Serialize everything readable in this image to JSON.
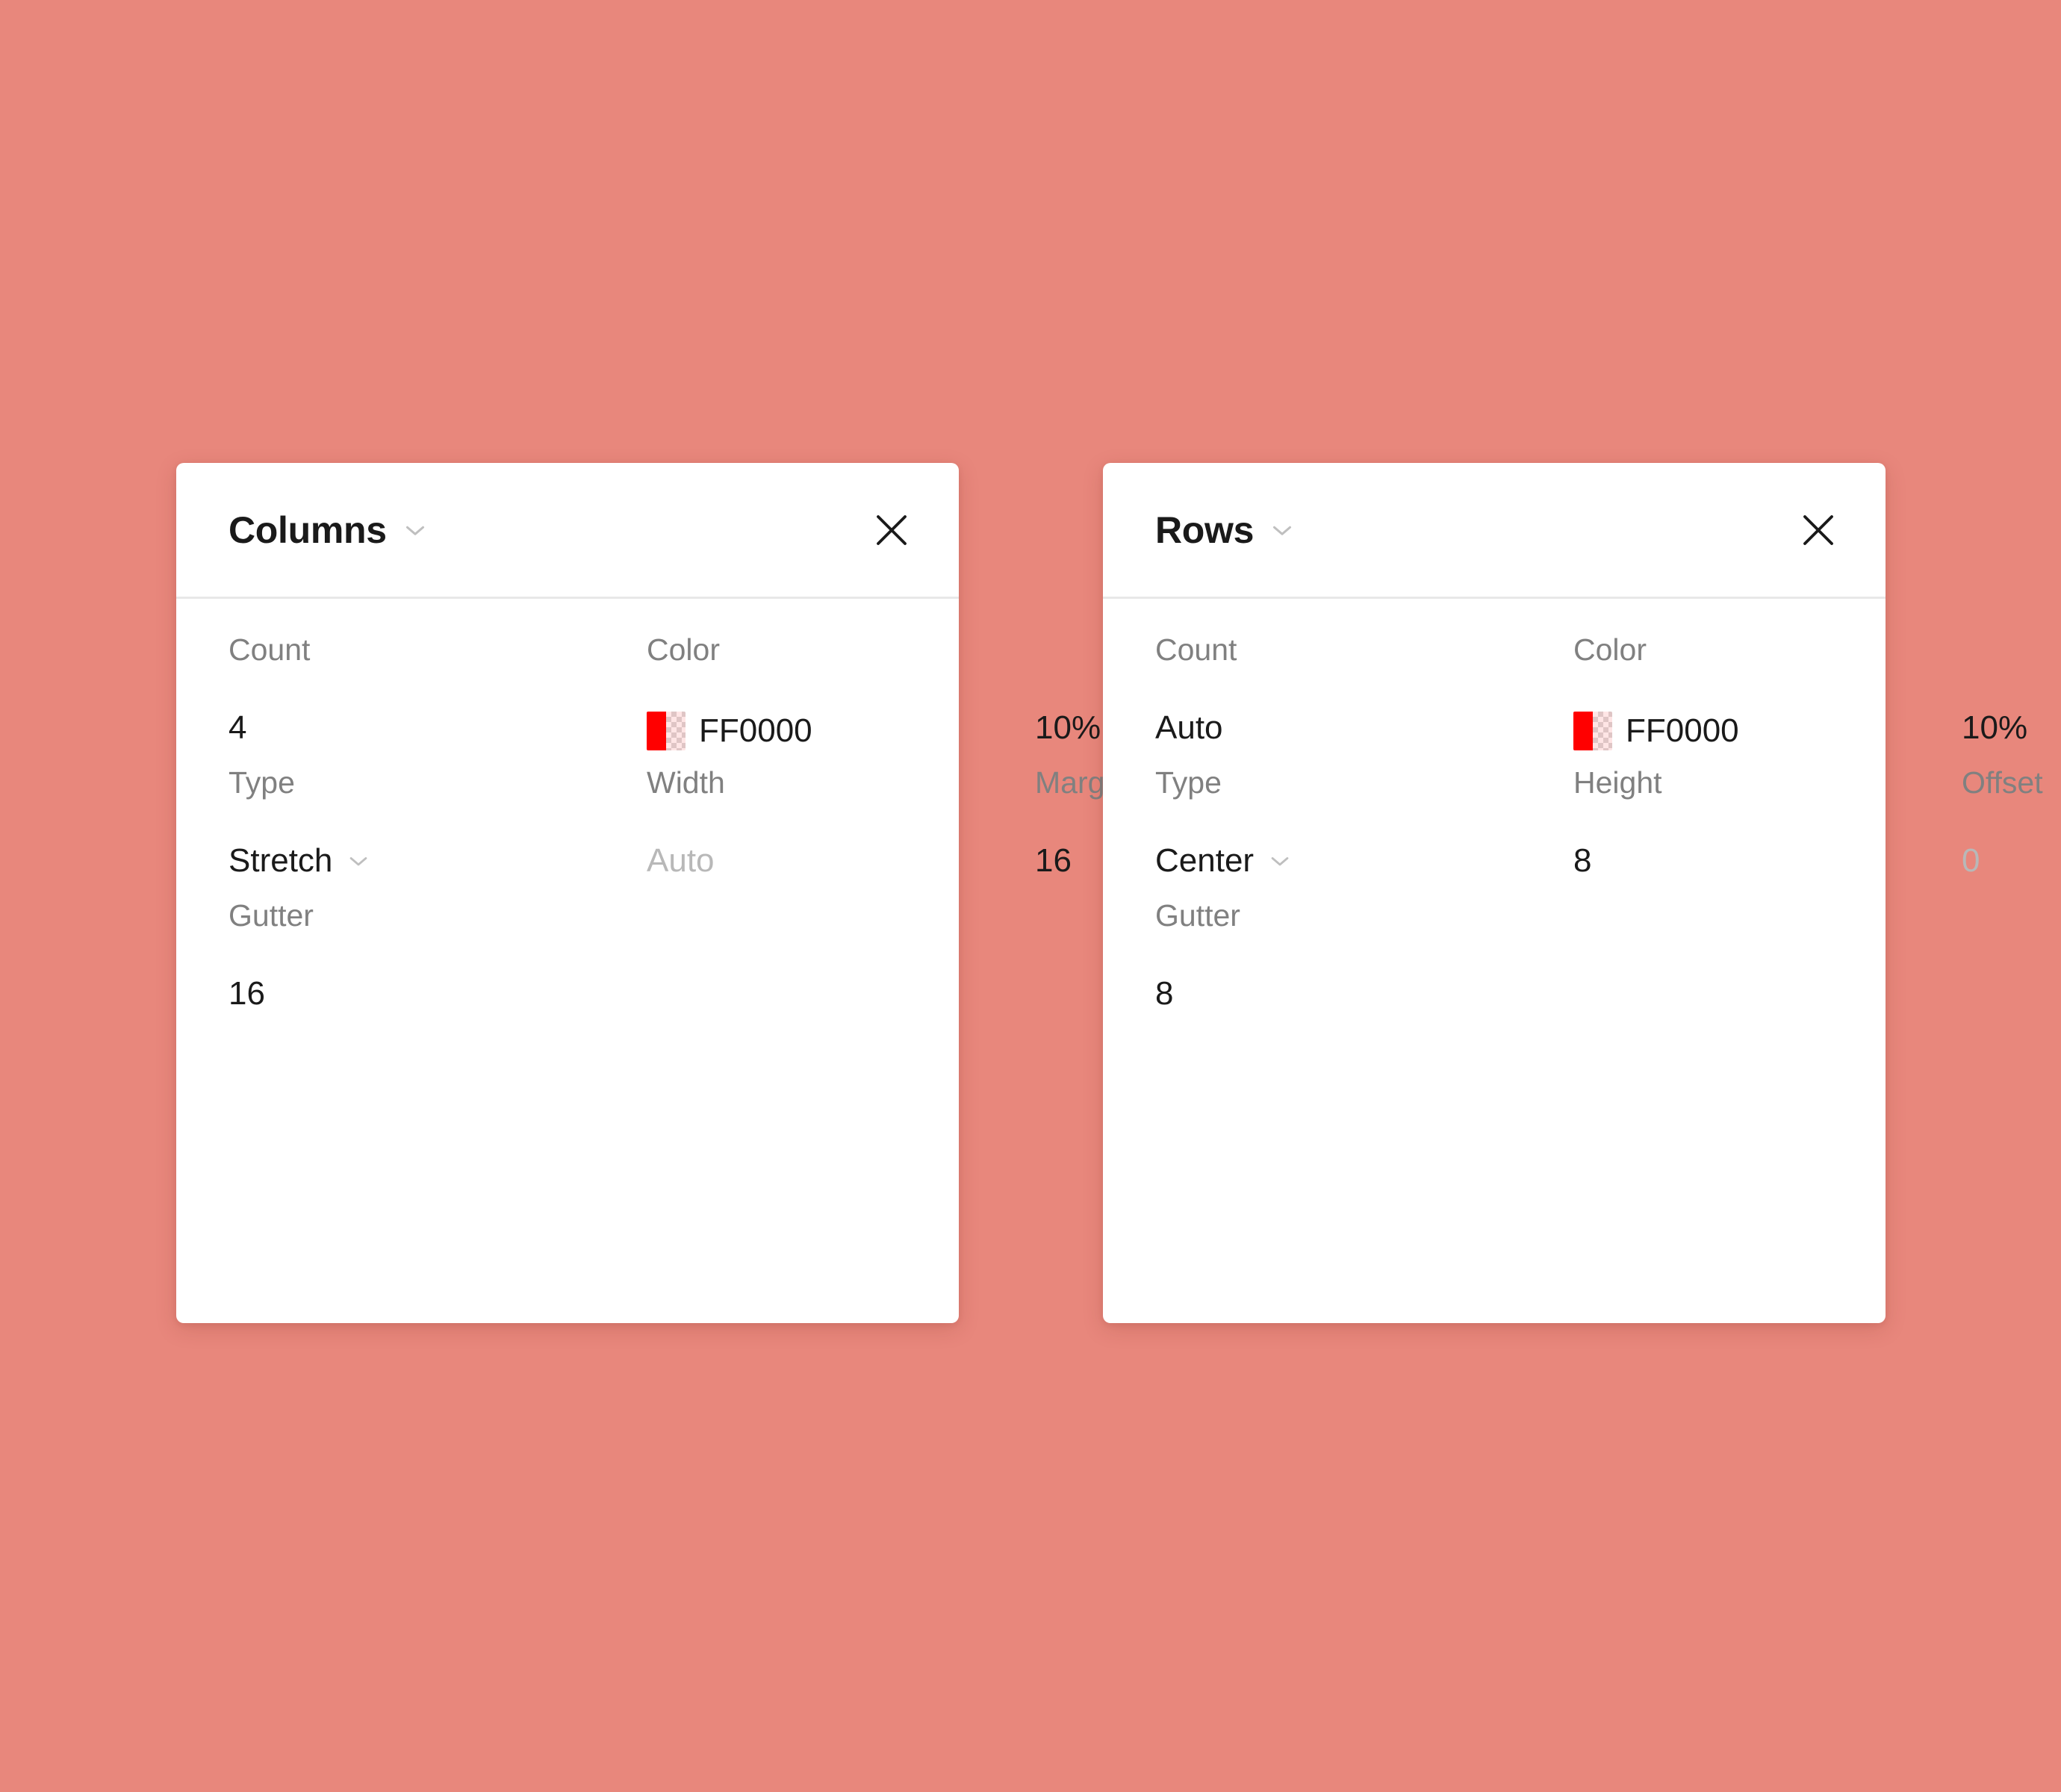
{
  "background_color": "#E8877C",
  "panels": [
    {
      "id": "columns",
      "title": "Columns",
      "title_chevron_icon": "chevron-down-icon",
      "close_icon": "close-icon",
      "rows": [
        {
          "cells": [
            {
              "label": "Count",
              "value": "4",
              "kind": "input"
            },
            {
              "label": "Color",
              "value": "FF0000",
              "kind": "color",
              "swatch_color": "#FF0000",
              "swatch_alpha_tint": "rgba(255,0,0,0.10)"
            },
            {
              "label": "",
              "value": "10%",
              "kind": "input"
            }
          ]
        },
        {
          "cells": [
            {
              "label": "Type",
              "value": "Stretch",
              "kind": "select"
            },
            {
              "label": "Width",
              "value": "Auto",
              "kind": "input",
              "placeholder": true
            },
            {
              "label": "Margin",
              "value": "16",
              "kind": "input"
            }
          ]
        },
        {
          "cells": [
            {
              "label": "Gutter",
              "value": "16",
              "kind": "input"
            }
          ]
        }
      ]
    },
    {
      "id": "rows",
      "title": "Rows",
      "title_chevron_icon": "chevron-down-icon",
      "close_icon": "close-icon",
      "rows": [
        {
          "cells": [
            {
              "label": "Count",
              "value": "Auto",
              "kind": "input"
            },
            {
              "label": "Color",
              "value": "FF0000",
              "kind": "color",
              "swatch_color": "#FF0000",
              "swatch_alpha_tint": "rgba(255,0,0,0.10)"
            },
            {
              "label": "",
              "value": "10%",
              "kind": "input"
            }
          ]
        },
        {
          "cells": [
            {
              "label": "Type",
              "value": "Center",
              "kind": "select"
            },
            {
              "label": "Height",
              "value": "8",
              "kind": "input"
            },
            {
              "label": "Offset",
              "value": "0",
              "kind": "input",
              "placeholder": true
            }
          ]
        },
        {
          "cells": [
            {
              "label": "Gutter",
              "value": "8",
              "kind": "input"
            }
          ]
        }
      ]
    }
  ]
}
